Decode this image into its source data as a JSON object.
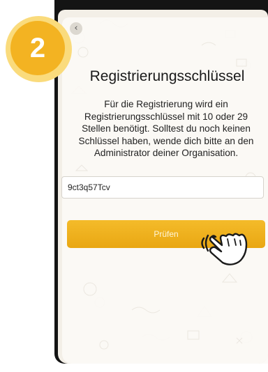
{
  "step_badge": {
    "number": "2"
  },
  "dialog": {
    "title": "Registrierungsschlüssel",
    "description": "Für die Registrierung wird ein Registrierungsschlüssel mit 10 oder 29 Stellen benötigt. Solltest du noch keinen Schlüssel haben, wende dich bitte an den Administrator deiner Organisation.",
    "key_input_value": "9ct3q57Tcv",
    "check_button_label": "Prüfen"
  },
  "icons": {
    "back": "chevron-left-icon",
    "hand": "tap-hand-icon",
    "background": "doodle-pattern"
  },
  "colors": {
    "accent": "#f3b322",
    "badge_outer": "#fadb7c",
    "button": "#eeaf1c"
  }
}
